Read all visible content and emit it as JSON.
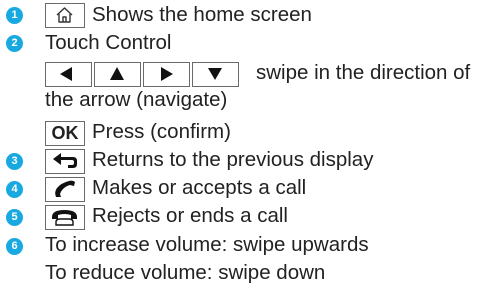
{
  "items": [
    {
      "number": "1",
      "text": "Shows the home screen",
      "icon": "home-icon"
    },
    {
      "number": "2",
      "text": "Touch Control"
    },
    {
      "text_line1": "swipe in the direction of",
      "text_line2": "the arrow (navigate)",
      "icons": [
        "arrow-left-icon",
        "arrow-up-icon",
        "arrow-right-icon",
        "arrow-down-icon"
      ]
    },
    {
      "key_label": "OK",
      "text": "Press (confirm)"
    },
    {
      "number": "3",
      "text": "Returns to the previous display",
      "icon": "back-arrow-icon"
    },
    {
      "number": "4",
      "text": "Makes or accepts a call",
      "icon": "phone-accept-icon"
    },
    {
      "number": "5",
      "text": "Rejects or ends a call",
      "icon": "phone-hangup-icon"
    },
    {
      "number": "6",
      "text": "To increase volume: swipe upwards"
    },
    {
      "text": "To reduce volume: swipe down"
    }
  ],
  "colors": {
    "badge": "#19a9e1",
    "text": "#222222",
    "key_border": "#6a6a6a"
  }
}
